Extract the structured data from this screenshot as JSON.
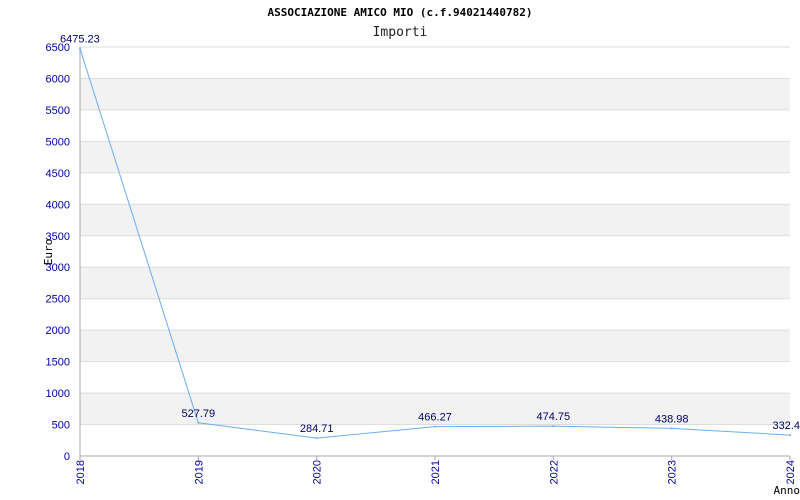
{
  "chart_data": {
    "type": "line",
    "title": "ASSOCIAZIONE AMICO MIO (c.f.94021440782)",
    "subtitle": "Importi",
    "xlabel": "Anno",
    "ylabel": "Euro",
    "categories": [
      "2018",
      "2019",
      "2020",
      "2021",
      "2022",
      "2023",
      "2024"
    ],
    "series": [
      {
        "values": [
          6475.23,
          527.79,
          284.71,
          466.27,
          474.75,
          438.98,
          332.4
        ]
      }
    ],
    "data_labels": [
      "6475.23",
      "527.79",
      "284.71",
      "466.27",
      "474.75",
      "438.98",
      "332.4"
    ],
    "yticks": [
      "0",
      "500",
      "1000",
      "1500",
      "2000",
      "2500",
      "3000",
      "3500",
      "4000",
      "4500",
      "5000",
      "5500",
      "6000",
      "6500"
    ],
    "ylim": [
      0,
      6500
    ],
    "grid": "horizontal bands",
    "line_color": "#6aaef0",
    "band_color": "#f2f2f2",
    "tick_color": "#0000aa"
  }
}
